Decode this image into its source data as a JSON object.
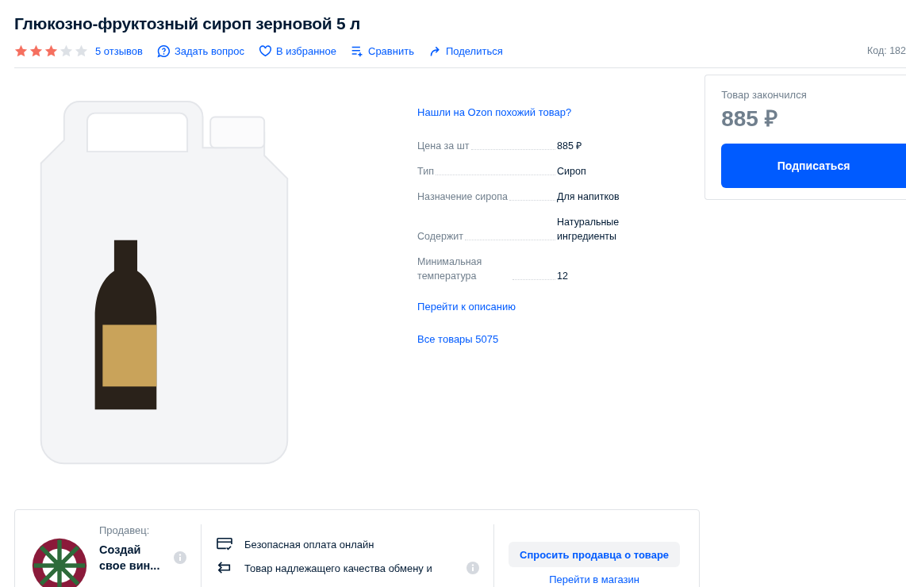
{
  "title": "Глюкозно-фруктозный сироп зерновой 5 л",
  "rating": {
    "stars": 3,
    "reviews": "5 отзывов"
  },
  "actions": [
    {
      "kind": "question",
      "label": "Задать вопрос"
    },
    {
      "kind": "favorite",
      "label": "В избранное"
    },
    {
      "kind": "compare",
      "label": "Сравнить"
    },
    {
      "kind": "share",
      "label": "Поделиться"
    }
  ],
  "code": "Код: 182",
  "similar_link": "Нашли на Ozon похожий товар?",
  "specs": [
    {
      "name": "Цена за шт",
      "value": "885 ₽"
    },
    {
      "name": "Тип",
      "value": "Сироп"
    },
    {
      "name": "Назначение сиропа",
      "value": "Для напитков"
    },
    {
      "name": "Содержит",
      "value": "Натуральные ингредиенты"
    },
    {
      "name": "Минимальная температура",
      "value": "12"
    }
  ],
  "description_link": "Перейти к описанию",
  "all_products_link": "Все товары 5075",
  "offer": {
    "status": "Товар закончился",
    "price": "885 ₽",
    "button": "Подписаться"
  },
  "seller": {
    "label": "Продавец:",
    "name": "Создай свое вин..."
  },
  "guarantees": [
    {
      "kind": "card",
      "text": "Безопасная оплата онлайн"
    },
    {
      "kind": "return",
      "text": "Товар надлежащего качества обмену и"
    }
  ],
  "seller_buttons": [
    {
      "kind": "primary",
      "label": "Спросить продавца о товаре"
    },
    {
      "kind": "link",
      "label": "Перейти в магазин"
    }
  ]
}
